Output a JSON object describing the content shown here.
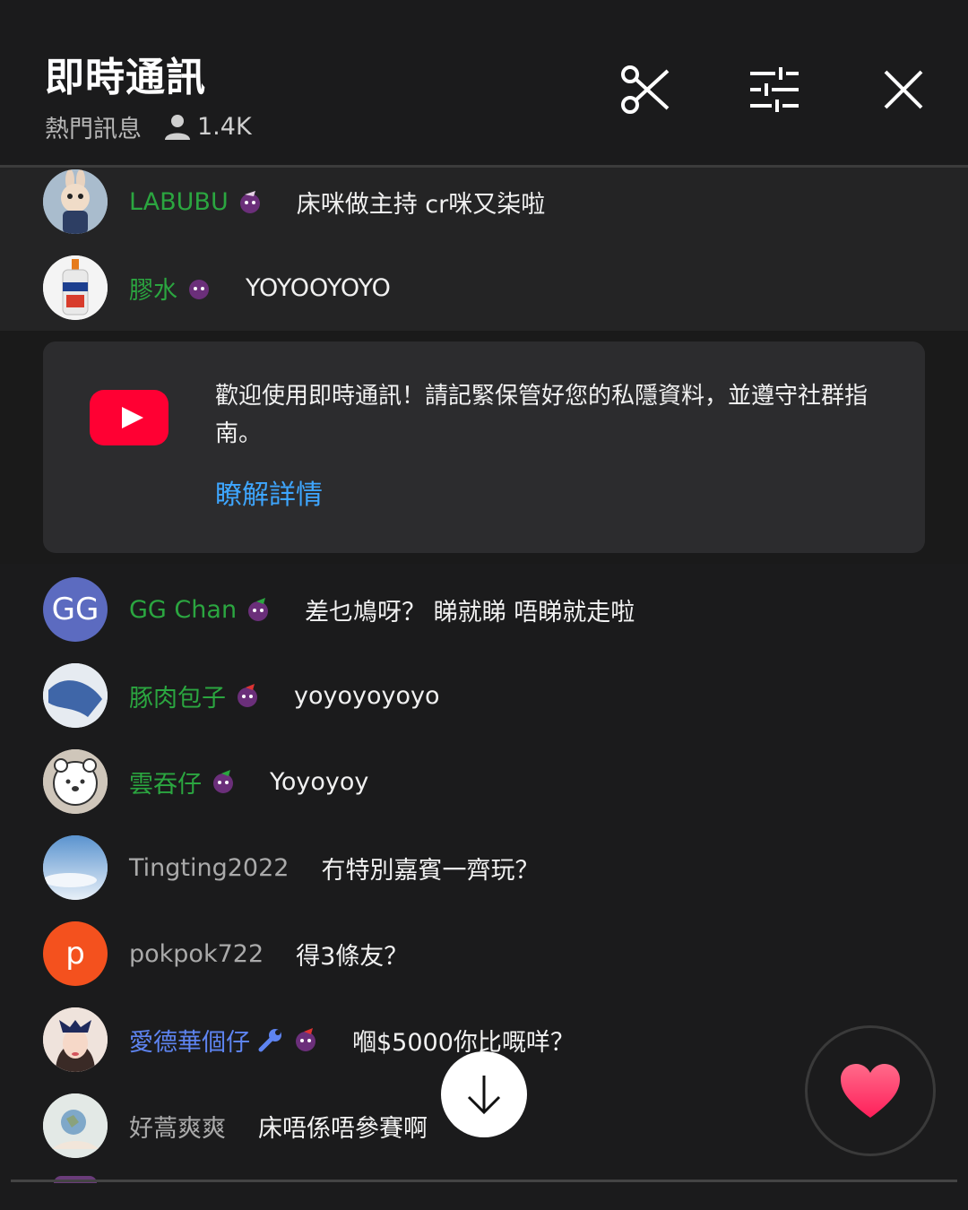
{
  "header": {
    "title": "即時通訊",
    "mode": "熱門訊息",
    "viewers": "1.4K",
    "icons": [
      "scissors-icon",
      "sliders-icon",
      "close-icon"
    ]
  },
  "pinned_messages": [
    {
      "author": "LABUBU",
      "text": "床咪做主持 cr咪又柒啦",
      "author_style": "member"
    },
    {
      "author": "膠水",
      "text": "YOYOOYOYO",
      "author_style": "member"
    }
  ],
  "notice": {
    "text": "歡迎使用即時通訊！請記緊保管好您的私隱資料，並遵守社群指南。",
    "link": "瞭解詳情"
  },
  "messages": [
    {
      "author": "GG Chan",
      "text": "差乜鳩呀？ 睇就睇 唔睇就走啦",
      "author_style": "member",
      "avatar_initials": "GG"
    },
    {
      "author": "豚肉包子",
      "text": "yoyoyoyoyo",
      "author_style": "member"
    },
    {
      "author": "雲吞仔",
      "text": "Yoyoyoy",
      "author_style": "member"
    },
    {
      "author": "Tingting2022",
      "text": "冇特別嘉賓一齊玩？",
      "author_style": "normal"
    },
    {
      "author": "pokpok722",
      "text": "得3條友？",
      "author_style": "normal",
      "avatar_initials": "p"
    },
    {
      "author": "愛德華個仔",
      "text": "嗰$5000你比嘅咩？",
      "author_style": "mod"
    },
    {
      "author": "好蒿爽爽",
      "text": "床唔係唔參賽啊",
      "author_style": "normal"
    }
  ],
  "colors": {
    "background": "#1b1b1c",
    "member_name": "#2ba640",
    "moderator_name": "#5e84f1",
    "link": "#3ea6ff",
    "youtube_red": "#ff0033"
  }
}
